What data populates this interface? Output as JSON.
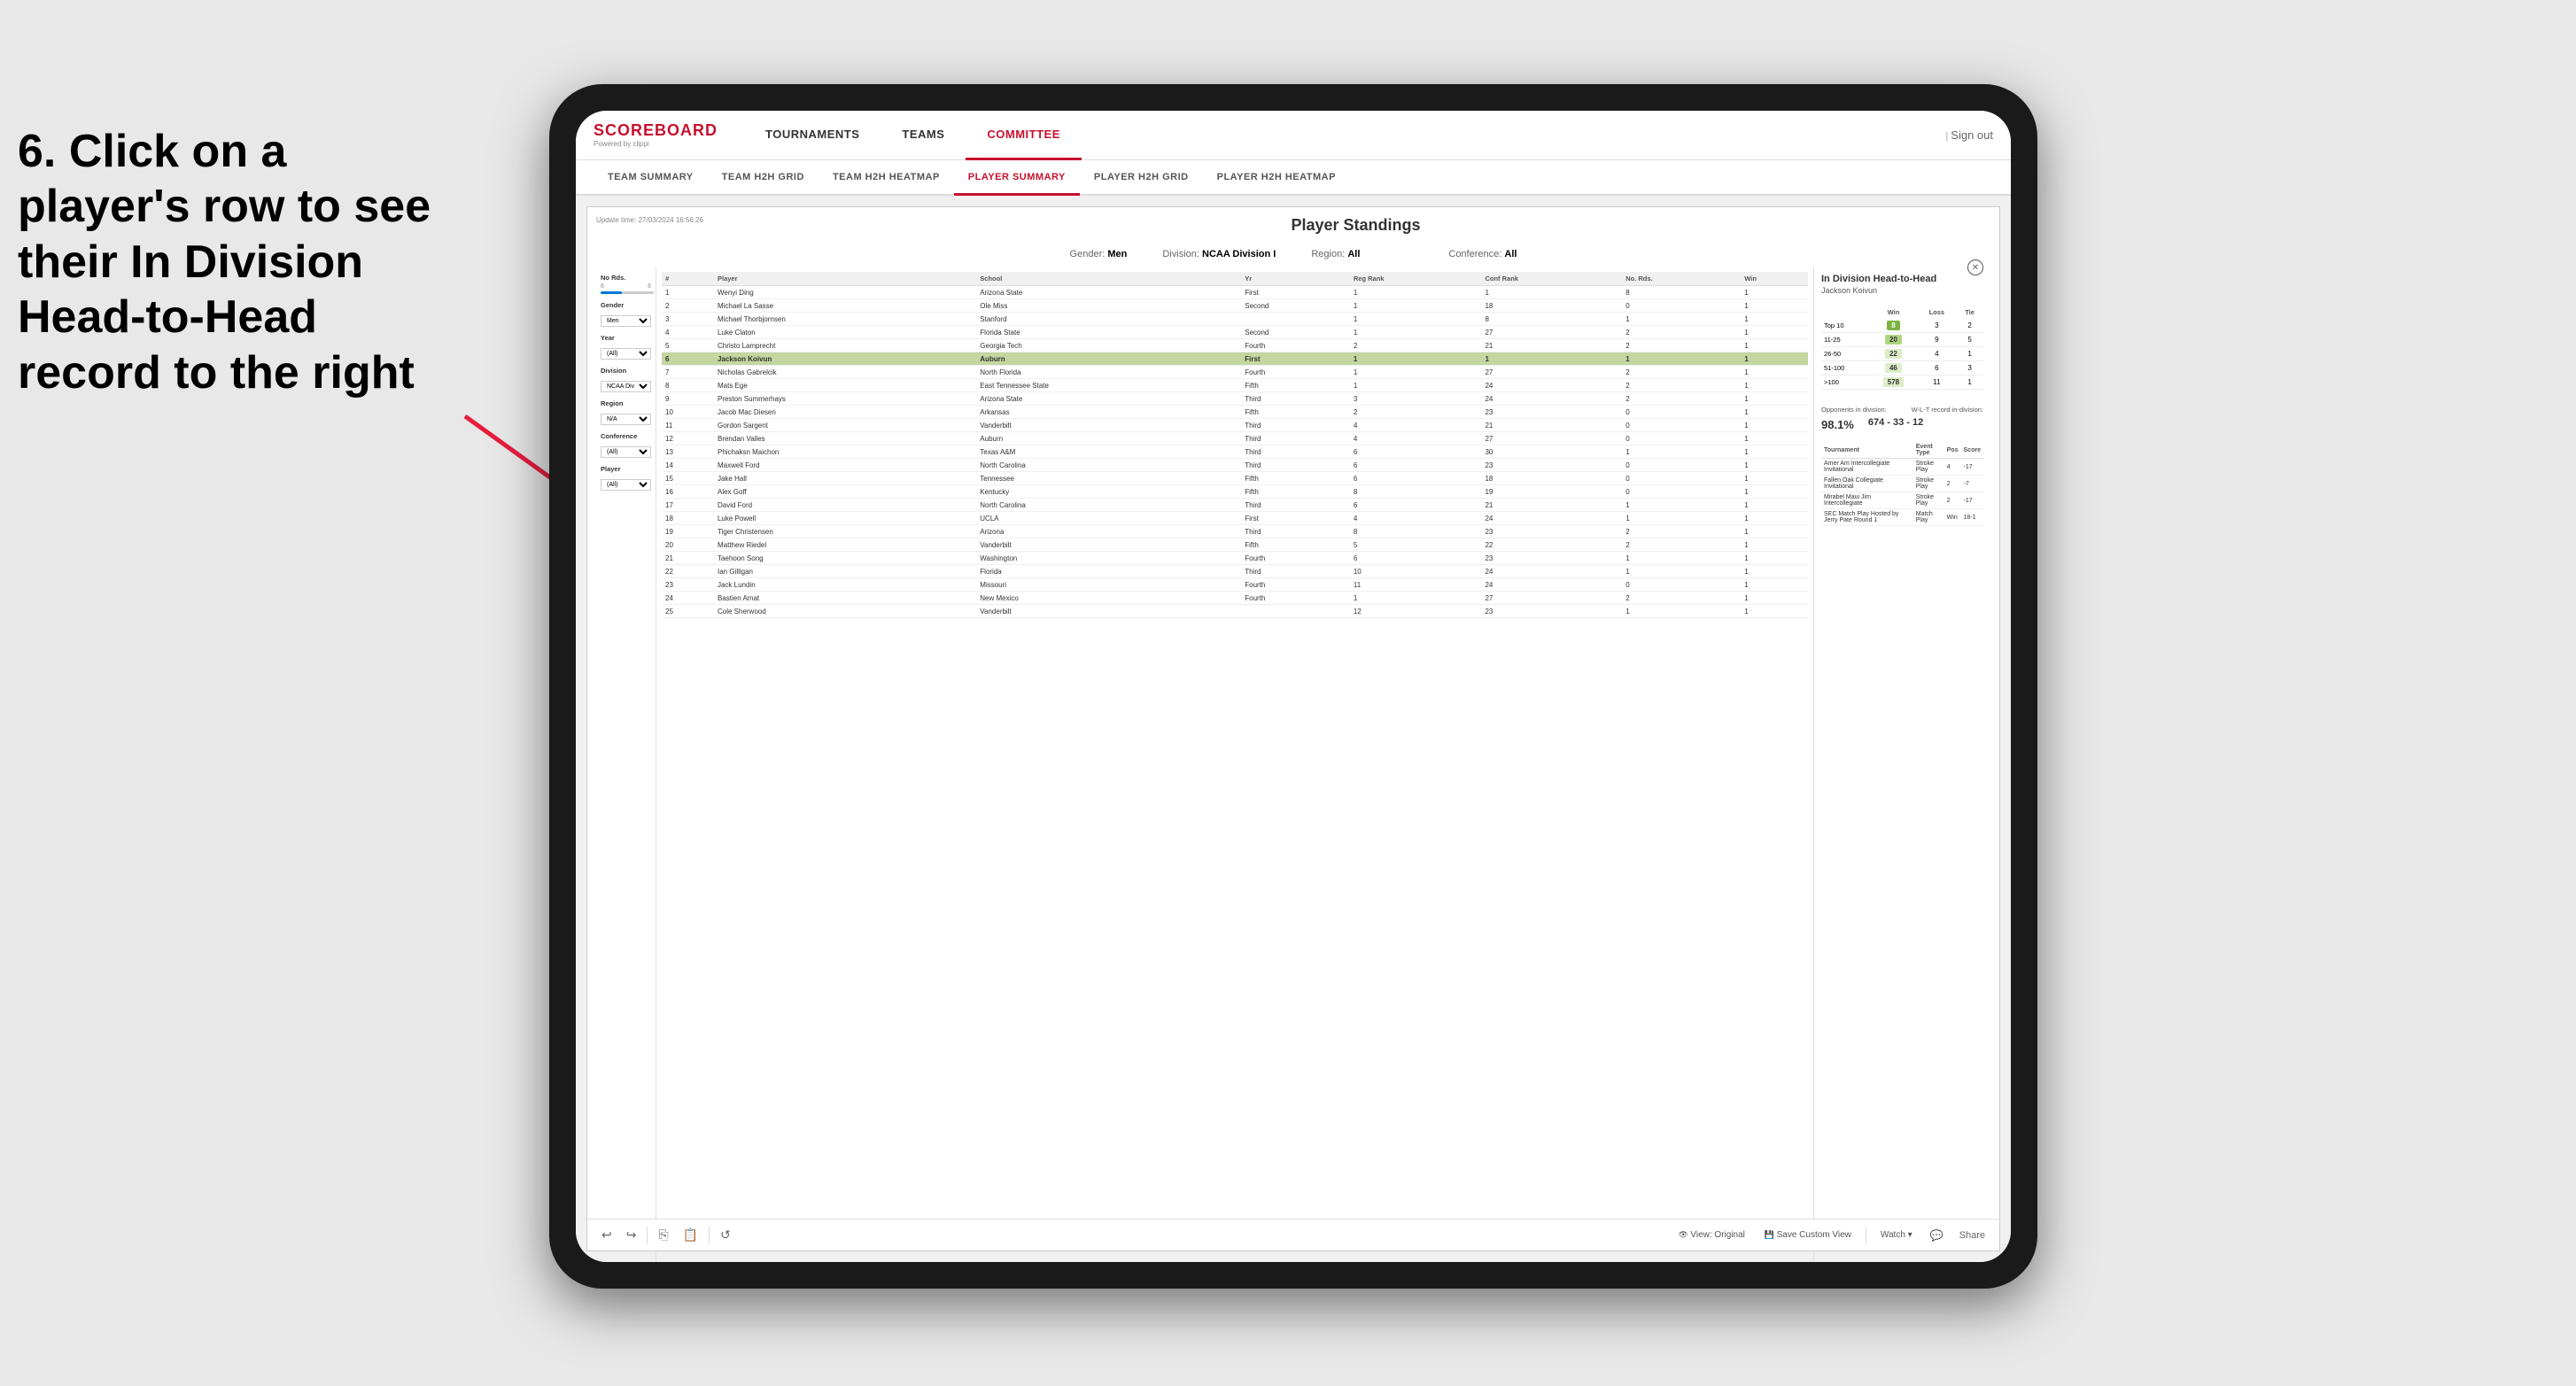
{
  "instruction": {
    "line1": "6. Click on a",
    "line2": "player's row to see",
    "line3": "their In Division",
    "line4": "Head-to-Head",
    "line5": "record to the right"
  },
  "nav": {
    "logo": "SCOREBOARD",
    "powered_by": "Powered by clippi",
    "items": [
      {
        "label": "TOURNAMENTS",
        "active": false
      },
      {
        "label": "TEAMS",
        "active": false
      },
      {
        "label": "COMMITTEE",
        "active": false
      }
    ],
    "sign_out": "Sign out"
  },
  "sub_nav": {
    "items": [
      {
        "label": "TEAM SUMMARY",
        "active": false
      },
      {
        "label": "TEAM H2H GRID",
        "active": false
      },
      {
        "label": "TEAM H2H HEATMAP",
        "active": false
      },
      {
        "label": "PLAYER SUMMARY",
        "active": true
      },
      {
        "label": "PLAYER H2H GRID",
        "active": false
      },
      {
        "label": "PLAYER H2H HEATMAP",
        "active": false
      }
    ]
  },
  "report": {
    "update_time_label": "Update time:",
    "update_time_value": "27/03/2024 16:56:26",
    "title": "Player Standings",
    "gender_label": "Gender:",
    "gender_value": "Men",
    "division_label": "Division:",
    "division_value": "NCAA Division I",
    "region_label": "Region:",
    "region_value": "All",
    "conference_label": "Conference:",
    "conference_value": "All"
  },
  "filters": {
    "no_rds": {
      "label": "No Rds.",
      "min": 6,
      "max": 6
    },
    "gender": {
      "label": "Gender",
      "value": "Men"
    },
    "year": {
      "label": "Year",
      "value": "(All)"
    },
    "division": {
      "label": "Division",
      "value": "NCAA Division I"
    },
    "region": {
      "label": "Region",
      "value": "N/A"
    },
    "conference": {
      "label": "Conference",
      "value": "(All)"
    },
    "player": {
      "label": "Player",
      "value": "(All)"
    }
  },
  "table": {
    "headers": [
      "#",
      "Player",
      "School",
      "Yr",
      "Reg Rank",
      "Conf Rank",
      "No. Rds.",
      "Win"
    ],
    "rows": [
      {
        "num": 1,
        "player": "Wenyi Ding",
        "school": "Arizona State",
        "yr": "First",
        "reg": 1,
        "conf": 1,
        "rds": 8,
        "win": 1,
        "selected": false
      },
      {
        "num": 2,
        "player": "Michael La Sasse",
        "school": "Ole Miss",
        "yr": "Second",
        "reg": 1,
        "conf": 18,
        "rds": 0,
        "win": 1,
        "selected": false
      },
      {
        "num": 3,
        "player": "Michael Thorbjornsen",
        "school": "Stanford",
        "yr": "",
        "reg": 1,
        "conf": 8,
        "rds": 1,
        "win": 1,
        "selected": false
      },
      {
        "num": 4,
        "player": "Luke Claton",
        "school": "Florida State",
        "yr": "Second",
        "reg": 1,
        "conf": 27,
        "rds": 2,
        "win": 1,
        "selected": false
      },
      {
        "num": 5,
        "player": "Christo Lamprecht",
        "school": "Georgia Tech",
        "yr": "Fourth",
        "reg": 2,
        "conf": 21,
        "rds": 2,
        "win": 1,
        "selected": false
      },
      {
        "num": 6,
        "player": "Jackson Koivun",
        "school": "Auburn",
        "yr": "First",
        "reg": 1,
        "conf": 1,
        "rds": 1,
        "win": 1,
        "selected": true
      },
      {
        "num": 7,
        "player": "Nicholas Gabrelcik",
        "school": "North Florida",
        "yr": "Fourth",
        "reg": 1,
        "conf": 27,
        "rds": 2,
        "win": 1,
        "selected": false
      },
      {
        "num": 8,
        "player": "Mats Ege",
        "school": "East Tennessee State",
        "yr": "Fifth",
        "reg": 1,
        "conf": 24,
        "rds": 2,
        "win": 1,
        "selected": false
      },
      {
        "num": 9,
        "player": "Preston Summerhays",
        "school": "Arizona State",
        "yr": "Third",
        "reg": 3,
        "conf": 24,
        "rds": 2,
        "win": 1,
        "selected": false
      },
      {
        "num": 10,
        "player": "Jacob Mac Diesen",
        "school": "Arkansas",
        "yr": "Fifth",
        "reg": 2,
        "conf": 23,
        "rds": 0,
        "win": 1,
        "selected": false
      },
      {
        "num": 11,
        "player": "Gordon Sargent",
        "school": "Vanderbilt",
        "yr": "Third",
        "reg": 4,
        "conf": 21,
        "rds": 0,
        "win": 1,
        "selected": false
      },
      {
        "num": 12,
        "player": "Brendan Valles",
        "school": "Auburn",
        "yr": "Third",
        "reg": 4,
        "conf": 27,
        "rds": 0,
        "win": 1,
        "selected": false
      },
      {
        "num": 13,
        "player": "Phichaksn Maichon",
        "school": "Texas A&M",
        "yr": "Third",
        "reg": 6,
        "conf": 30,
        "rds": 1,
        "win": 1,
        "selected": false
      },
      {
        "num": 14,
        "player": "Maxwell Ford",
        "school": "North Carolina",
        "yr": "Third",
        "reg": 6,
        "conf": 23,
        "rds": 0,
        "win": 1,
        "selected": false
      },
      {
        "num": 15,
        "player": "Jake Hall",
        "school": "Tennessee",
        "yr": "Fifth",
        "reg": 6,
        "conf": 18,
        "rds": 0,
        "win": 1,
        "selected": false
      },
      {
        "num": 16,
        "player": "Alex Goff",
        "school": "Kentucky",
        "yr": "Fifth",
        "reg": 8,
        "conf": 19,
        "rds": 0,
        "win": 1,
        "selected": false
      },
      {
        "num": 17,
        "player": "David Ford",
        "school": "North Carolina",
        "yr": "Third",
        "reg": 6,
        "conf": 21,
        "rds": 1,
        "win": 1,
        "selected": false
      },
      {
        "num": 18,
        "player": "Luke Powell",
        "school": "UCLA",
        "yr": "First",
        "reg": 4,
        "conf": 24,
        "rds": 1,
        "win": 1,
        "selected": false
      },
      {
        "num": 19,
        "player": "Tiger Christensen",
        "school": "Arizona",
        "yr": "Third",
        "reg": 8,
        "conf": 23,
        "rds": 2,
        "win": 1,
        "selected": false
      },
      {
        "num": 20,
        "player": "Matthew Riedel",
        "school": "Vanderbilt",
        "yr": "Fifth",
        "reg": 5,
        "conf": 22,
        "rds": 2,
        "win": 1,
        "selected": false
      },
      {
        "num": 21,
        "player": "Taehoon Song",
        "school": "Washington",
        "yr": "Fourth",
        "reg": 6,
        "conf": 23,
        "rds": 1,
        "win": 1,
        "selected": false
      },
      {
        "num": 22,
        "player": "Ian Gilligan",
        "school": "Florida",
        "yr": "Third",
        "reg": 10,
        "conf": 24,
        "rds": 1,
        "win": 1,
        "selected": false
      },
      {
        "num": 23,
        "player": "Jack Lundin",
        "school": "Missouri",
        "yr": "Fourth",
        "reg": 11,
        "conf": 24,
        "rds": 0,
        "win": 1,
        "selected": false
      },
      {
        "num": 24,
        "player": "Bastien Amat",
        "school": "New Mexico",
        "yr": "Fourth",
        "reg": 1,
        "conf": 27,
        "rds": 2,
        "win": 1,
        "selected": false
      },
      {
        "num": 25,
        "player": "Cole Sherwood",
        "school": "Vanderbilt",
        "yr": "",
        "reg": 12,
        "conf": 23,
        "rds": 1,
        "win": 1,
        "selected": false
      }
    ]
  },
  "h2h": {
    "title": "In Division Head-to-Head",
    "player_name": "Jackson Koivun",
    "close_btn": "✕",
    "columns": [
      "Win",
      "Loss",
      "Tie"
    ],
    "rows": [
      {
        "label": "Top 10",
        "win": 8,
        "loss": 3,
        "tie": 2,
        "highlight": "dark-green"
      },
      {
        "label": "11-25",
        "win": 20,
        "loss": 9,
        "tie": 5,
        "highlight": "light-green"
      },
      {
        "label": "26-50",
        "win": 22,
        "loss": 4,
        "tie": 1,
        "highlight": "pale-green"
      },
      {
        "label": "51-100",
        "win": 46,
        "loss": 6,
        "tie": 3,
        "highlight": "pale-green"
      },
      {
        "label": ">100",
        "win": 578,
        "loss": 11,
        "tie": 1,
        "highlight": "pale-green"
      }
    ],
    "opponents_label": "Opponents in division:",
    "wl_label": "W-L-T record in-division:",
    "opponents_pct": "98.1%",
    "record": "674 - 33 - 12",
    "tournament_headers": [
      "Tournament",
      "Event Type",
      "Pos",
      "Score"
    ],
    "tournaments": [
      {
        "name": "Amer Am Intercollegiate Invitational",
        "type": "Stroke Play",
        "pos": 4,
        "score": "-17"
      },
      {
        "name": "Fallen Oak Collegiate Invitational",
        "type": "Stroke Play",
        "pos": 2,
        "score": "-7"
      },
      {
        "name": "Mirabel Maui Jim Intercollegiate",
        "type": "Stroke Play",
        "pos": 2,
        "score": "-17"
      },
      {
        "name": "SEC Match Play Hosted by Jerry Pate Round 1",
        "type": "Match Play",
        "pos": "Win",
        "score": "18-1"
      }
    ]
  },
  "toolbar": {
    "view_original": "View: Original",
    "save_custom": "Save Custom View",
    "watch": "Watch ▾",
    "share": "Share"
  }
}
